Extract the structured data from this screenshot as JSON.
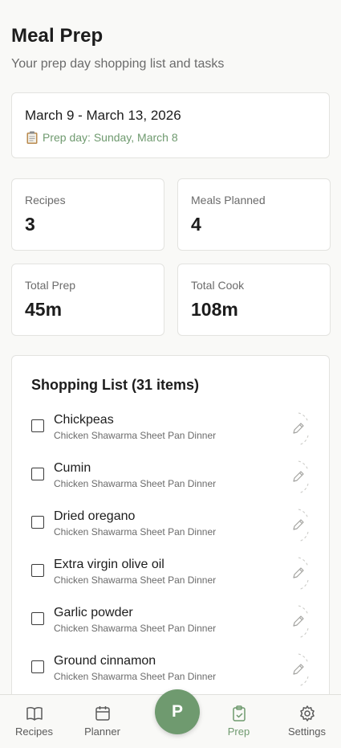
{
  "header": {
    "title": "Meal Prep",
    "subtitle": "Your prep day shopping list and tasks"
  },
  "week": {
    "range": "March 9 - March 13, 2026",
    "prep_day": "Prep day: Sunday, March 8"
  },
  "stats": [
    {
      "label": "Recipes",
      "value": "3"
    },
    {
      "label": "Meals Planned",
      "value": "4"
    },
    {
      "label": "Total Prep",
      "value": "45m"
    },
    {
      "label": "Total Cook",
      "value": "108m"
    }
  ],
  "shopping": {
    "title": "Shopping List (31 items)",
    "items": [
      {
        "name": "Chickpeas",
        "recipe": "Chicken Shawarma Sheet Pan Dinner"
      },
      {
        "name": "Cumin",
        "recipe": "Chicken Shawarma Sheet Pan Dinner"
      },
      {
        "name": "Dried oregano",
        "recipe": "Chicken Shawarma Sheet Pan Dinner"
      },
      {
        "name": "Extra virgin olive oil",
        "recipe": "Chicken Shawarma Sheet Pan Dinner"
      },
      {
        "name": "Garlic powder",
        "recipe": "Chicken Shawarma Sheet Pan Dinner"
      },
      {
        "name": "Ground cinnamon",
        "recipe": "Chicken Shawarma Sheet Pan Dinner"
      }
    ]
  },
  "nav": {
    "recipes": "Recipes",
    "planner": "Planner",
    "fab": "P",
    "prep": "Prep",
    "settings": "Settings"
  },
  "colors": {
    "accent": "#6f9a6f",
    "background": "#f9f9f7",
    "card": "#ffffff"
  },
  "icons": {
    "prep_day": "clipboard-icon",
    "edit": "pencil-icon",
    "recipes": "book-icon",
    "planner": "calendar-icon",
    "prep": "clipboard-check-icon",
    "settings": "gear-icon"
  }
}
